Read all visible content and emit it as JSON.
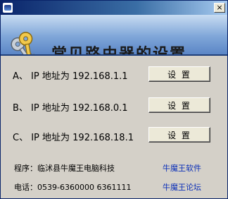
{
  "window": {
    "title": "",
    "close_symbol": "×"
  },
  "banner": {
    "title": "常见路由器的设置",
    "logo_icon": "keys-icon"
  },
  "routers": [
    {
      "label": "A、 IP 地址为 192.168.1.1",
      "button": "设 置"
    },
    {
      "label": "B、 IP 地址为 192.168.0.1",
      "button": "设 置"
    },
    {
      "label": "C、 IP 地址为 192.168.18.1",
      "button": "设 置"
    }
  ],
  "footer": {
    "program": "程序：临沭县牛魔王电脑科技",
    "phone": "电话：0539-6360000  6361111",
    "link_software": "牛魔王软件",
    "link_forum": "牛魔王论坛"
  },
  "colors": {
    "link": "#0b2fb8",
    "title_bar": "#0a246a",
    "face": "#d4d0c8"
  }
}
